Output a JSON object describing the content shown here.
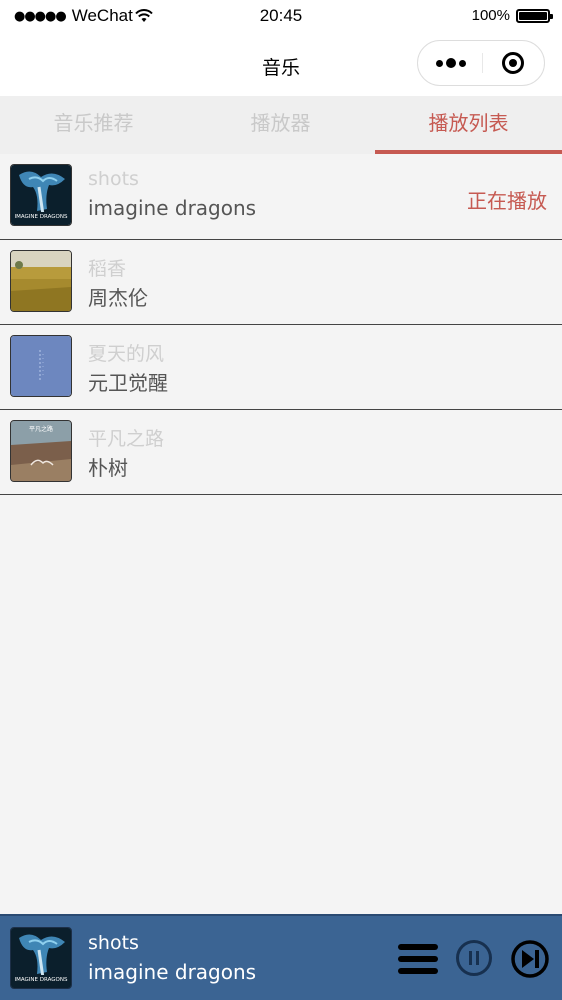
{
  "status_bar": {
    "signal_dots": "●●●●●",
    "carrier": "WeChat",
    "wifi_icon": "wifi-icon",
    "time": "20:45",
    "battery": "100%"
  },
  "nav": {
    "title": "音乐"
  },
  "tabs": [
    {
      "label": "音乐推荐",
      "active": false
    },
    {
      "label": "播放器",
      "active": false
    },
    {
      "label": "播放列表",
      "active": true
    }
  ],
  "playlist": [
    {
      "title": "shots",
      "artist": "imagine dragons",
      "status": "正在播放",
      "cover_text": "IMAGINE DRAGONS"
    },
    {
      "title": "稻香",
      "artist": "周杰伦",
      "status": ""
    },
    {
      "title": "夏天的风",
      "artist": "元卫觉醒",
      "status": ""
    },
    {
      "title": "平凡之路",
      "artist": "朴树",
      "status": "",
      "cover_text": "平凡之路"
    }
  ],
  "player": {
    "title": "shots",
    "artist": "imagine dragons",
    "state": "playing"
  },
  "colors": {
    "accent": "#c65a52",
    "player_bg": "#3b6493",
    "page_bg": "#f4f4f4",
    "tab_bg": "#efefef"
  }
}
